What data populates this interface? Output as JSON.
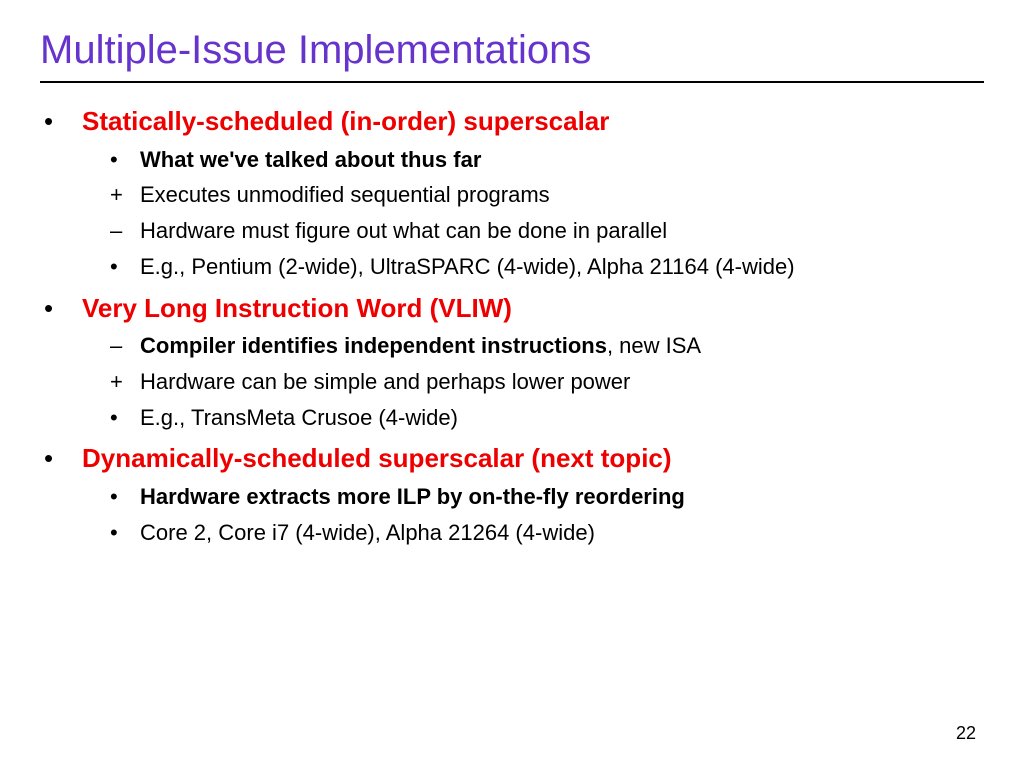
{
  "title": "Multiple-Issue Implementations",
  "sections": [
    {
      "heading": "Statically-scheduled (in-order) superscalar",
      "items": [
        {
          "bullet": "•",
          "bold": "What we've talked about thus far",
          "rest": ""
        },
        {
          "bullet": "+",
          "bold": "",
          "rest": "Executes unmodified sequential programs"
        },
        {
          "bullet": "–",
          "bold": "",
          "rest": "Hardware must figure out what can be done in parallel"
        },
        {
          "bullet": "•",
          "bold": "",
          "rest": "E.g., Pentium (2-wide), UltraSPARC (4-wide), Alpha 21164 (4-wide)"
        }
      ]
    },
    {
      "heading": "Very Long Instruction Word (VLIW)",
      "items": [
        {
          "bullet": "–",
          "bold": "Compiler identifies independent instructions",
          "rest": ", new ISA"
        },
        {
          "bullet": "+",
          "bold": "",
          "rest": "Hardware can be simple and perhaps lower power"
        },
        {
          "bullet": "•",
          "bold": "",
          "rest": "E.g., TransMeta Crusoe (4-wide)"
        }
      ]
    },
    {
      "heading": "Dynamically-scheduled superscalar (next topic)",
      "items": [
        {
          "bullet": "•",
          "bold": "Hardware extracts more ILP by on-the-fly reordering",
          "rest": ""
        },
        {
          "bullet": "•",
          "bold": "",
          "rest": "Core 2, Core i7 (4-wide), Alpha 21264 (4-wide)"
        }
      ]
    }
  ],
  "pageNumber": "22"
}
